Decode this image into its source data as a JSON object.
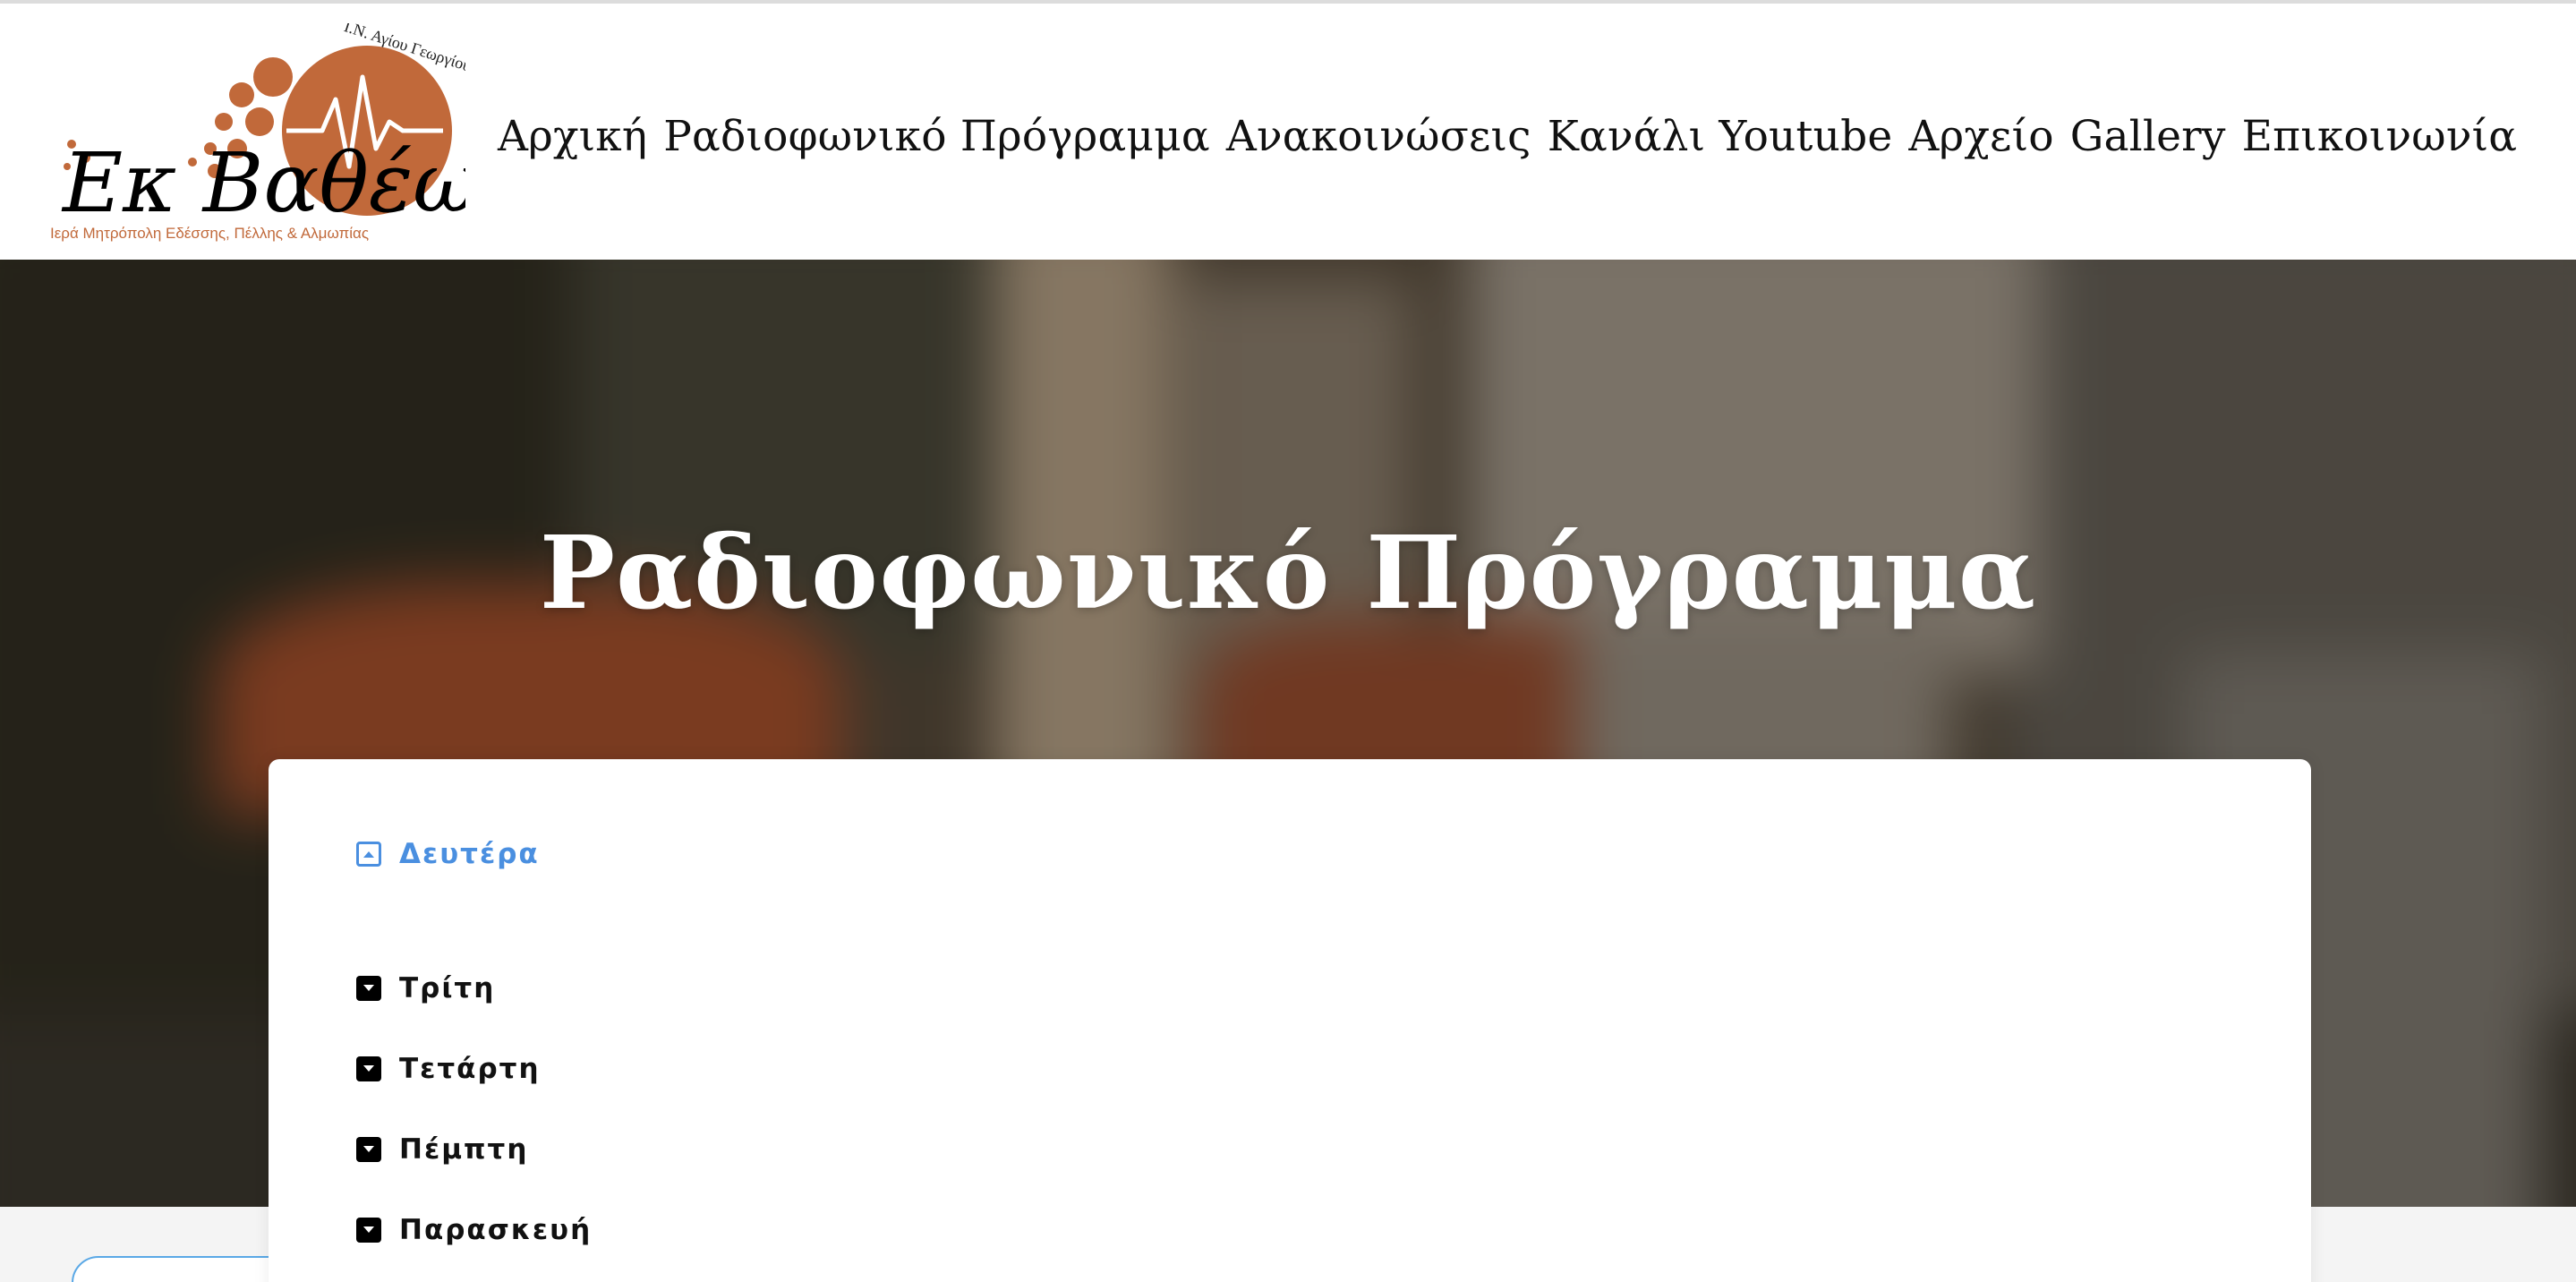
{
  "logo": {
    "alt": "Εκ Βαθέων",
    "lettering": [
      "Ι.Ν. Αγίου Γεωργίου",
      "Εκ Βαθέων",
      "Ιερά Μητρόπολη Εδέσσης, Πέλλης & Αλμωπίας"
    ]
  },
  "nav": {
    "items": [
      "Αρχική",
      "Ραδιοφωνικό Πρόγραμμα",
      "Ανακοινώσεις",
      "Κανάλι Youtube",
      "Αρχείο",
      "Gallery",
      "Επικοινωνία"
    ]
  },
  "hero": {
    "title": "Ραδιοφωνικό Πρόγραμμα"
  },
  "schedule": {
    "days": [
      {
        "label": "Δευτέρα",
        "state": "expanded"
      },
      {
        "label": "Τρίτη",
        "state": "collapsed"
      },
      {
        "label": "Τετάρτη",
        "state": "collapsed"
      },
      {
        "label": "Πέμπτη",
        "state": "collapsed"
      },
      {
        "label": "Παρασκευή",
        "state": "collapsed"
      }
    ]
  },
  "colors": {
    "accent": "#4a8fe0",
    "brand": "#c1693a",
    "text": "#111111"
  },
  "icons": {
    "expanded": "caret-square-up-icon",
    "collapsed": "caret-square-down-icon"
  }
}
